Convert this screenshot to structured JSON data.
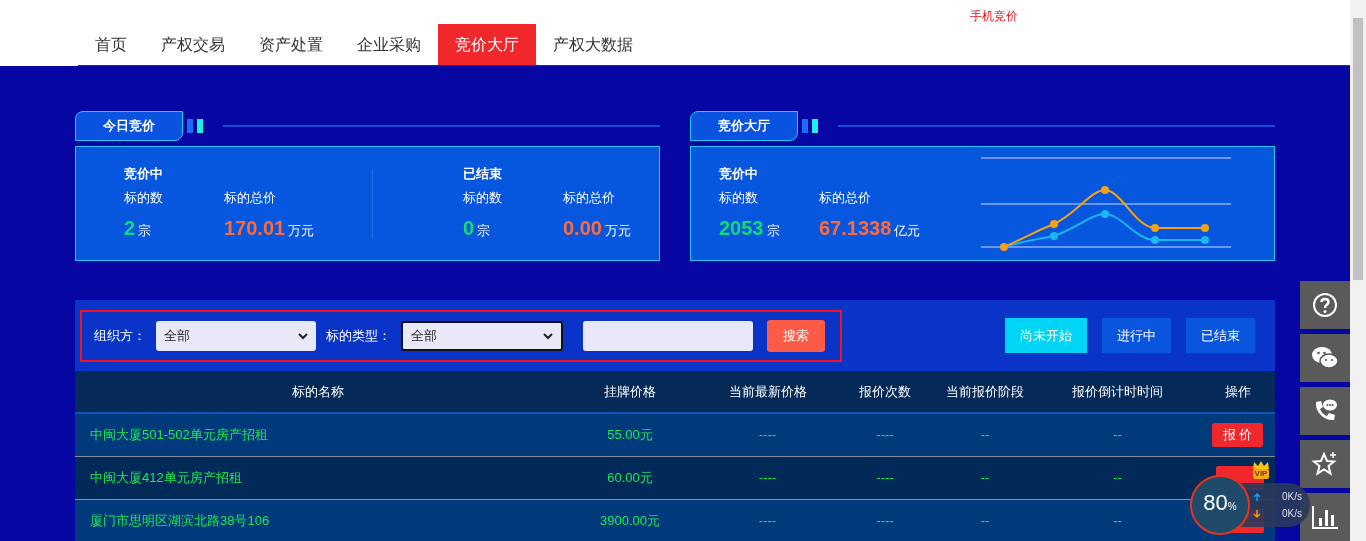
{
  "top_link": "手机竞价",
  "nav": [
    {
      "label": "首页",
      "selected": false
    },
    {
      "label": "产权交易",
      "selected": false
    },
    {
      "label": "资产处置",
      "selected": false
    },
    {
      "label": "企业采购",
      "selected": false
    },
    {
      "label": "竞价大厅",
      "selected": true
    },
    {
      "label": "产权大数据",
      "selected": false
    }
  ],
  "today_panel": {
    "title": "今日竞价",
    "groups": [
      {
        "heading": "竞价中",
        "count_label": "标的数",
        "total_label": "标的总价",
        "count": "2",
        "count_unit": "宗",
        "total": "170.01",
        "total_unit": "万元"
      },
      {
        "heading": "已结束",
        "count_label": "标的数",
        "total_label": "标的总价",
        "count": "0",
        "count_unit": "宗",
        "total": "0.00",
        "total_unit": "万元"
      }
    ]
  },
  "hall_panel": {
    "title": "竞价大厅",
    "group": {
      "heading": "竞价中",
      "count_label": "标的数",
      "total_label": "标的总价",
      "count": "2053",
      "count_unit": "宗",
      "total": "67.1338",
      "total_unit": "亿元"
    }
  },
  "filters": {
    "org_label": "组织方：",
    "org_value": "全部",
    "type_label": "标的类型：",
    "type_value": "全部",
    "search_button": "搜索"
  },
  "status_tabs": [
    {
      "label": "尚未开始",
      "selected": true
    },
    {
      "label": "进行中",
      "selected": false
    },
    {
      "label": "已结束",
      "selected": false
    }
  ],
  "table": {
    "columns": [
      "标的名称",
      "挂牌价格",
      "当前最新价格",
      "报价次数",
      "当前报价阶段",
      "报价倒计时时间",
      "操作"
    ],
    "rows": [
      {
        "name": "中闽大厦501-502单元房产招租",
        "price": "55.00元",
        "latest": "----",
        "count": "----",
        "stage": "--",
        "countdown": "--",
        "action": {
          "kind": "button",
          "label": "报 价"
        }
      },
      {
        "name": "中闽大厦412单元房产招租",
        "price": "60.00元",
        "latest": "----",
        "count": "----",
        "stage": "--",
        "countdown": "--",
        "action": {
          "kind": "covered"
        }
      },
      {
        "name": "厦门市思明区湖滨北路38号106",
        "price": "3900.00元",
        "latest": "----",
        "count": "----",
        "stage": "--",
        "countdown": "--",
        "action": {
          "kind": "covered"
        }
      }
    ]
  },
  "side_buttons": [
    {
      "kind": "help"
    },
    {
      "kind": "wechat"
    },
    {
      "kind": "phone"
    },
    {
      "kind": "favorite"
    },
    {
      "kind": "stats"
    }
  ],
  "speed_widget": {
    "percent": "80",
    "percent_unit": "%",
    "up": "0K/s",
    "down": "0K/s",
    "badge": "VIP"
  }
}
